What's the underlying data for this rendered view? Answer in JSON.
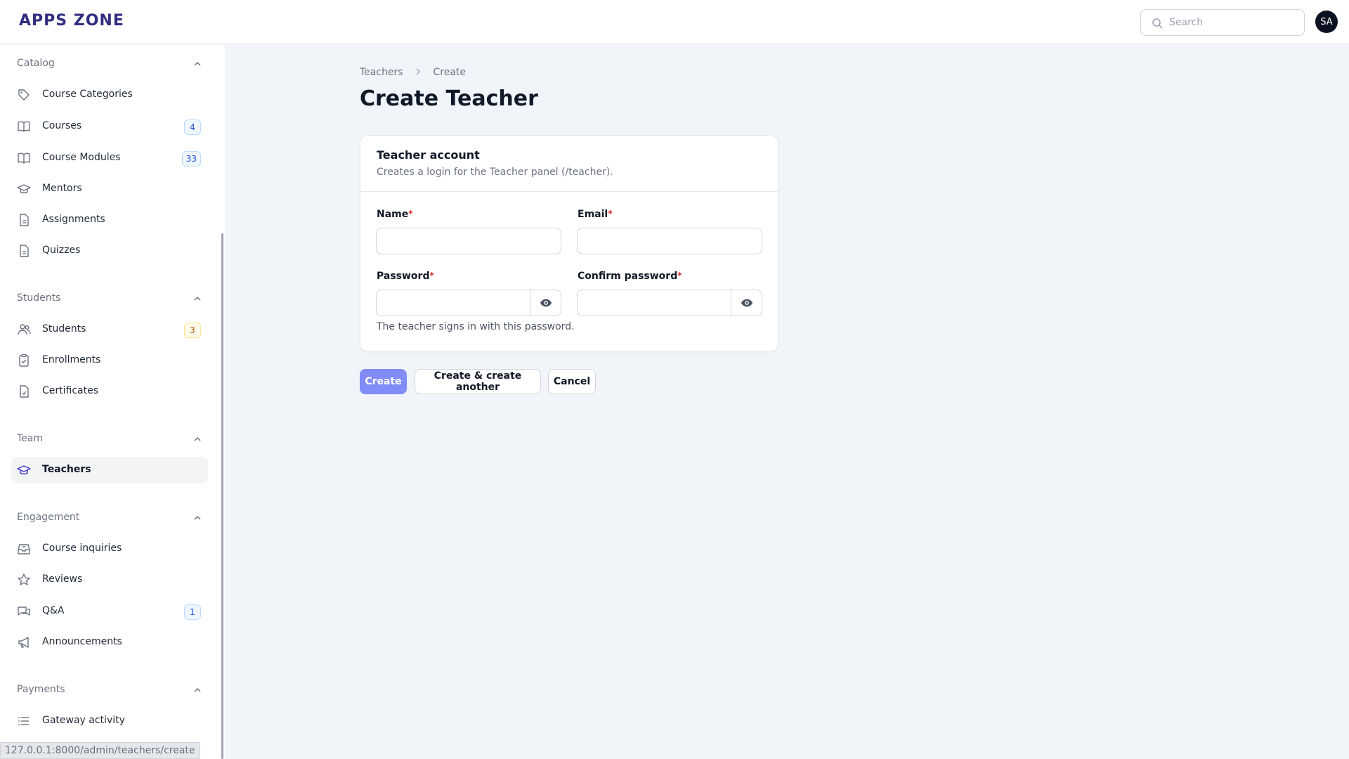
{
  "app": {
    "logo": "APPS ZONE"
  },
  "header": {
    "search": {
      "placeholder": "Search",
      "value": ""
    },
    "avatar_initials": "SA"
  },
  "sidebar": {
    "groups": [
      {
        "label": "Catalog",
        "items": [
          {
            "label": "Course Categories",
            "icon": "tag-icon"
          },
          {
            "label": "Courses",
            "icon": "book-icon",
            "badge": "4"
          },
          {
            "label": "Course Modules",
            "icon": "book-icon",
            "badge": "33"
          },
          {
            "label": "Mentors",
            "icon": "graduation-cap-icon"
          },
          {
            "label": "Assignments",
            "icon": "document-icon"
          },
          {
            "label": "Quizzes",
            "icon": "document-icon"
          }
        ]
      },
      {
        "label": "Students",
        "items": [
          {
            "label": "Students",
            "icon": "users-icon",
            "badge": "3"
          },
          {
            "label": "Enrollments",
            "icon": "clipboard-check-icon"
          },
          {
            "label": "Certificates",
            "icon": "document-check-icon"
          }
        ]
      },
      {
        "label": "Team",
        "items": [
          {
            "label": "Teachers",
            "icon": "graduation-cap-icon",
            "active": true
          }
        ]
      },
      {
        "label": "Engagement",
        "items": [
          {
            "label": "Course inquiries",
            "icon": "inbox-icon"
          },
          {
            "label": "Reviews",
            "icon": "star-icon"
          },
          {
            "label": "Q&A",
            "icon": "chat-bubbles-icon",
            "badge": "1"
          },
          {
            "label": "Announcements",
            "icon": "megaphone-icon"
          }
        ]
      },
      {
        "label": "Payments",
        "items": [
          {
            "label": "Gateway activity",
            "icon": "list-icon"
          }
        ]
      }
    ]
  },
  "breadcrumb": {
    "parent": "Teachers",
    "current": "Create"
  },
  "page": {
    "title": "Create Teacher"
  },
  "form": {
    "section_title": "Teacher account",
    "section_description": "Creates a login for the Teacher panel (/teacher).",
    "fields": {
      "name": {
        "label": "Name",
        "required_mark": "*",
        "value": ""
      },
      "email": {
        "label": "Email",
        "required_mark": "*",
        "value": ""
      },
      "password": {
        "label": "Password",
        "required_mark": "*",
        "value": "",
        "hint": "The teacher signs in with this password."
      },
      "confirm_password": {
        "label": "Confirm password",
        "required_mark": "*",
        "value": ""
      }
    }
  },
  "actions": {
    "create": "Create",
    "create_another": "Create & create another",
    "cancel": "Cancel"
  },
  "status_bar": {
    "url": "127.0.0.1:8000/admin/teachers/create"
  },
  "colors": {
    "primary": "#818cf8",
    "logo": "#312e81",
    "badge_blue": "#1d4ed8",
    "badge_amber": "#b45309"
  }
}
